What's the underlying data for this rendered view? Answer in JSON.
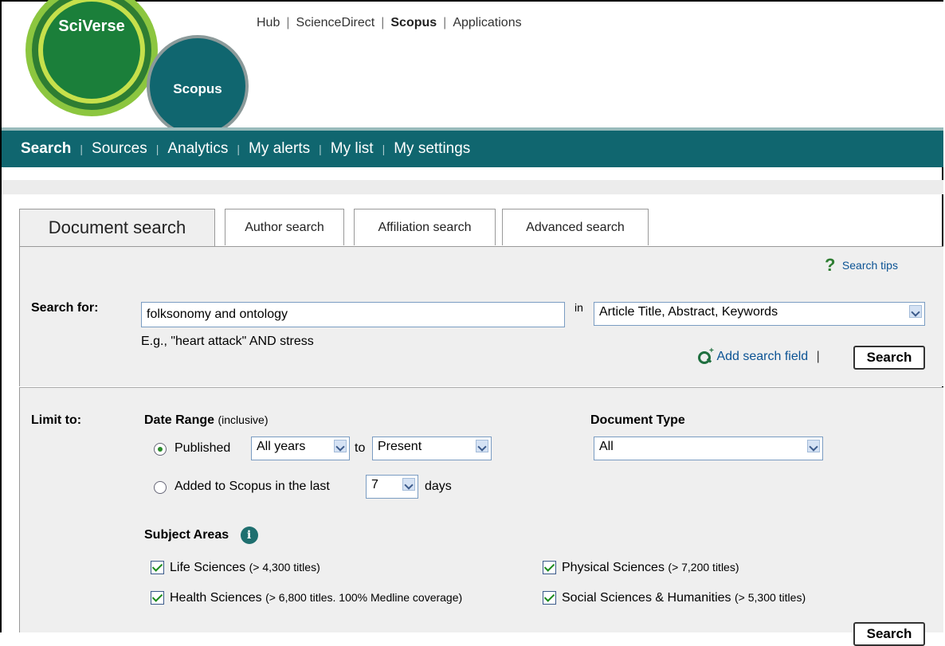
{
  "brand": {
    "sciverse": "SciVerse",
    "scopus": "Scopus"
  },
  "topnav": {
    "items": [
      "Hub",
      "ScienceDirect",
      "Scopus",
      "Applications"
    ],
    "active": "Scopus"
  },
  "mainnav": {
    "items": [
      "Search",
      "Sources",
      "Analytics",
      "My alerts",
      "My list",
      "My settings"
    ],
    "active": "Search"
  },
  "tabs": [
    "Document search",
    "Author search",
    "Affiliation search",
    "Advanced search"
  ],
  "search": {
    "search_tips": "Search tips",
    "search_for_label": "Search for:",
    "query": "folksonomy and ontology",
    "in_label": "in",
    "field": "Article Title, Abstract, Keywords",
    "example": "E.g., \"heart attack\" AND stress",
    "add_field": "Add search field",
    "separator": "|",
    "search_button": "Search"
  },
  "limit": {
    "label": "Limit to:",
    "date_range_label": "Date Range",
    "date_range_note": "(inclusive)",
    "published_label": "Published",
    "from_value": "All years",
    "to_label": "to",
    "to_value": "Present",
    "added_label": "Added to Scopus in the last",
    "days_value": "7",
    "days_label": "days",
    "doc_type_label": "Document Type",
    "doc_type_value": "All",
    "subject_label": "Subject Areas",
    "subjects": [
      {
        "name": "Life Sciences",
        "note": "(> 4,300 titles)"
      },
      {
        "name": "Physical Sciences",
        "note": "(> 7,200 titles)"
      },
      {
        "name": "Health Sciences",
        "note": "(> 6,800 titles. 100% Medline coverage)"
      },
      {
        "name": "Social Sciences & Humanities",
        "note": "(> 5,300 titles)"
      }
    ],
    "bottom_button": "Search"
  },
  "colors": {
    "nav_teal": "#10666f",
    "panel_gray": "#efefef",
    "link_blue": "#0b5394"
  }
}
